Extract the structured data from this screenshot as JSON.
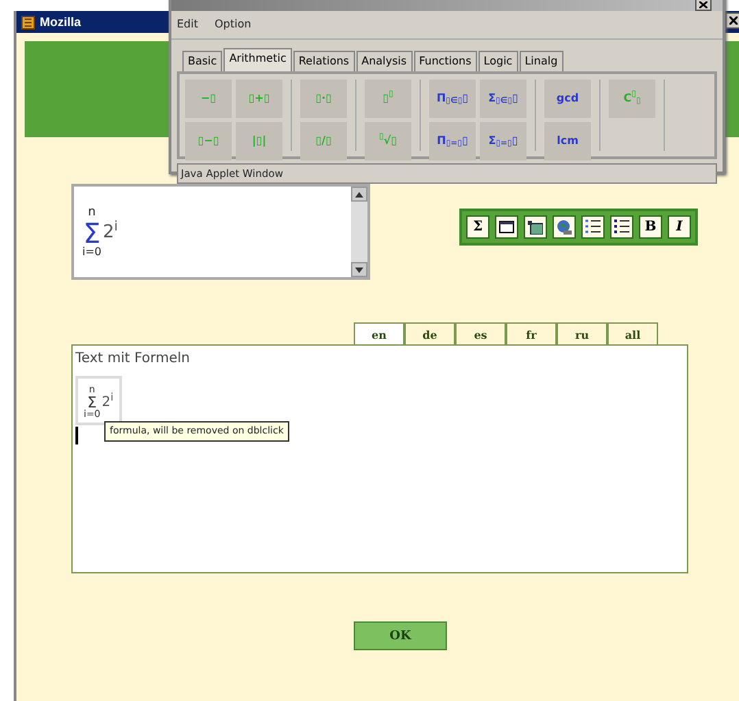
{
  "browser": {
    "title": "Mozilla"
  },
  "applet": {
    "menu": [
      "Edit",
      "Option"
    ],
    "tabs": [
      {
        "label": "Basic",
        "selected": false
      },
      {
        "label": "Arithmetic",
        "selected": true
      },
      {
        "label": "Relations",
        "selected": false
      },
      {
        "label": "Analysis",
        "selected": false
      },
      {
        "label": "Functions",
        "selected": false
      },
      {
        "label": "Logic",
        "selected": false
      },
      {
        "label": "Linalg",
        "selected": false
      }
    ],
    "groups": [
      {
        "rows": [
          [
            "−▯",
            "▯+▯"
          ],
          [
            "▯−▯",
            "|▯|"
          ]
        ]
      },
      {
        "rows": [
          [
            "▯·▯"
          ],
          [
            "▯/▯"
          ]
        ]
      },
      {
        "rows": [
          [
            "▯$^{▯}$"
          ],
          [
            "$^{▯}$√▯"
          ]
        ]
      },
      {
        "rows": [
          [
            "Π$_{▯∈▯}$▯",
            "Σ$_{▯∈▯}$▯"
          ],
          [
            "Π$_{▯=▯}$▯",
            "Σ$_{▯=▯}$▯"
          ]
        ]
      },
      {
        "rows": [
          [
            "gcd"
          ],
          [
            "lcm"
          ]
        ]
      },
      {
        "rows": [
          [
            "C$^{▯}$$_{▯}$"
          ]
        ]
      }
    ],
    "status": "Java Applet Window"
  },
  "preview": {
    "upper": "n",
    "symbol": "Σ",
    "base": "2",
    "exponent": "i",
    "lower": "i=0"
  },
  "toolbar": [
    {
      "kind": "text",
      "label": "Σ"
    },
    {
      "kind": "window"
    },
    {
      "kind": "image"
    },
    {
      "kind": "globe"
    },
    {
      "kind": "numbered"
    },
    {
      "kind": "bullets"
    },
    {
      "kind": "text",
      "label": "B"
    },
    {
      "kind": "italic",
      "label": "I"
    }
  ],
  "languages": [
    {
      "label": "en",
      "selected": true
    },
    {
      "label": "de",
      "selected": false
    },
    {
      "label": "es",
      "selected": false
    },
    {
      "label": "fr",
      "selected": false
    },
    {
      "label": "ru",
      "selected": false
    },
    {
      "label": "all",
      "selected": false
    }
  ],
  "editor": {
    "text": "Text mit Formeln",
    "formula": {
      "upper": "n",
      "symbol": "Σ",
      "base": "2",
      "exponent": "i",
      "lower": "i=0"
    },
    "tooltip": "formula, will be removed on dblclick"
  },
  "ok": "OK"
}
